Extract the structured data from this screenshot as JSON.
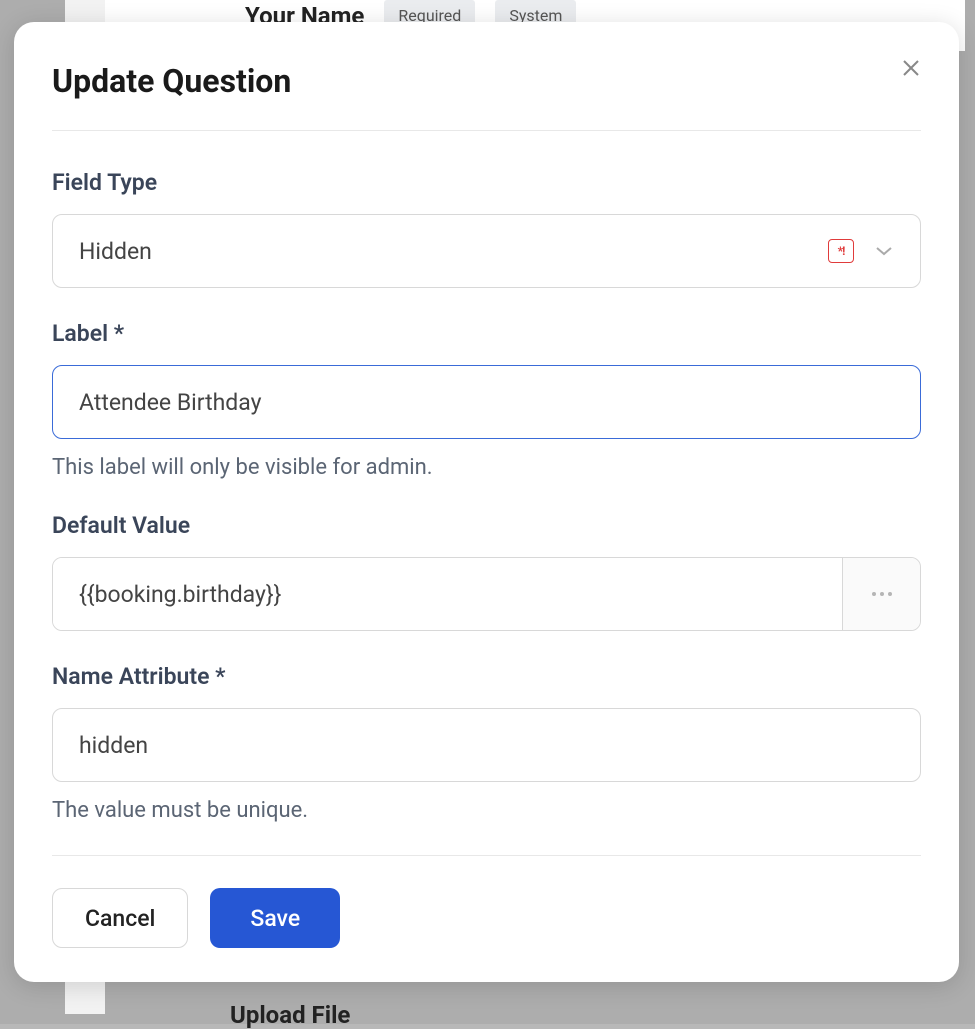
{
  "background": {
    "title": "Your Name",
    "tag1": "Required",
    "tag2": "System",
    "bottom": "Upload File"
  },
  "modal": {
    "title": "Update Question",
    "fields": {
      "fieldType": {
        "label": "Field Type",
        "value": "Hidden"
      },
      "label": {
        "label": "Label *",
        "value": "Attendee Birthday",
        "help": "This label will only be visible for admin."
      },
      "defaultValue": {
        "label": "Default Value",
        "value": "{{booking.birthday}}"
      },
      "nameAttribute": {
        "label": "Name Attribute *",
        "value": "hidden",
        "help": "The value must be unique."
      }
    },
    "buttons": {
      "cancel": "Cancel",
      "save": "Save"
    }
  }
}
